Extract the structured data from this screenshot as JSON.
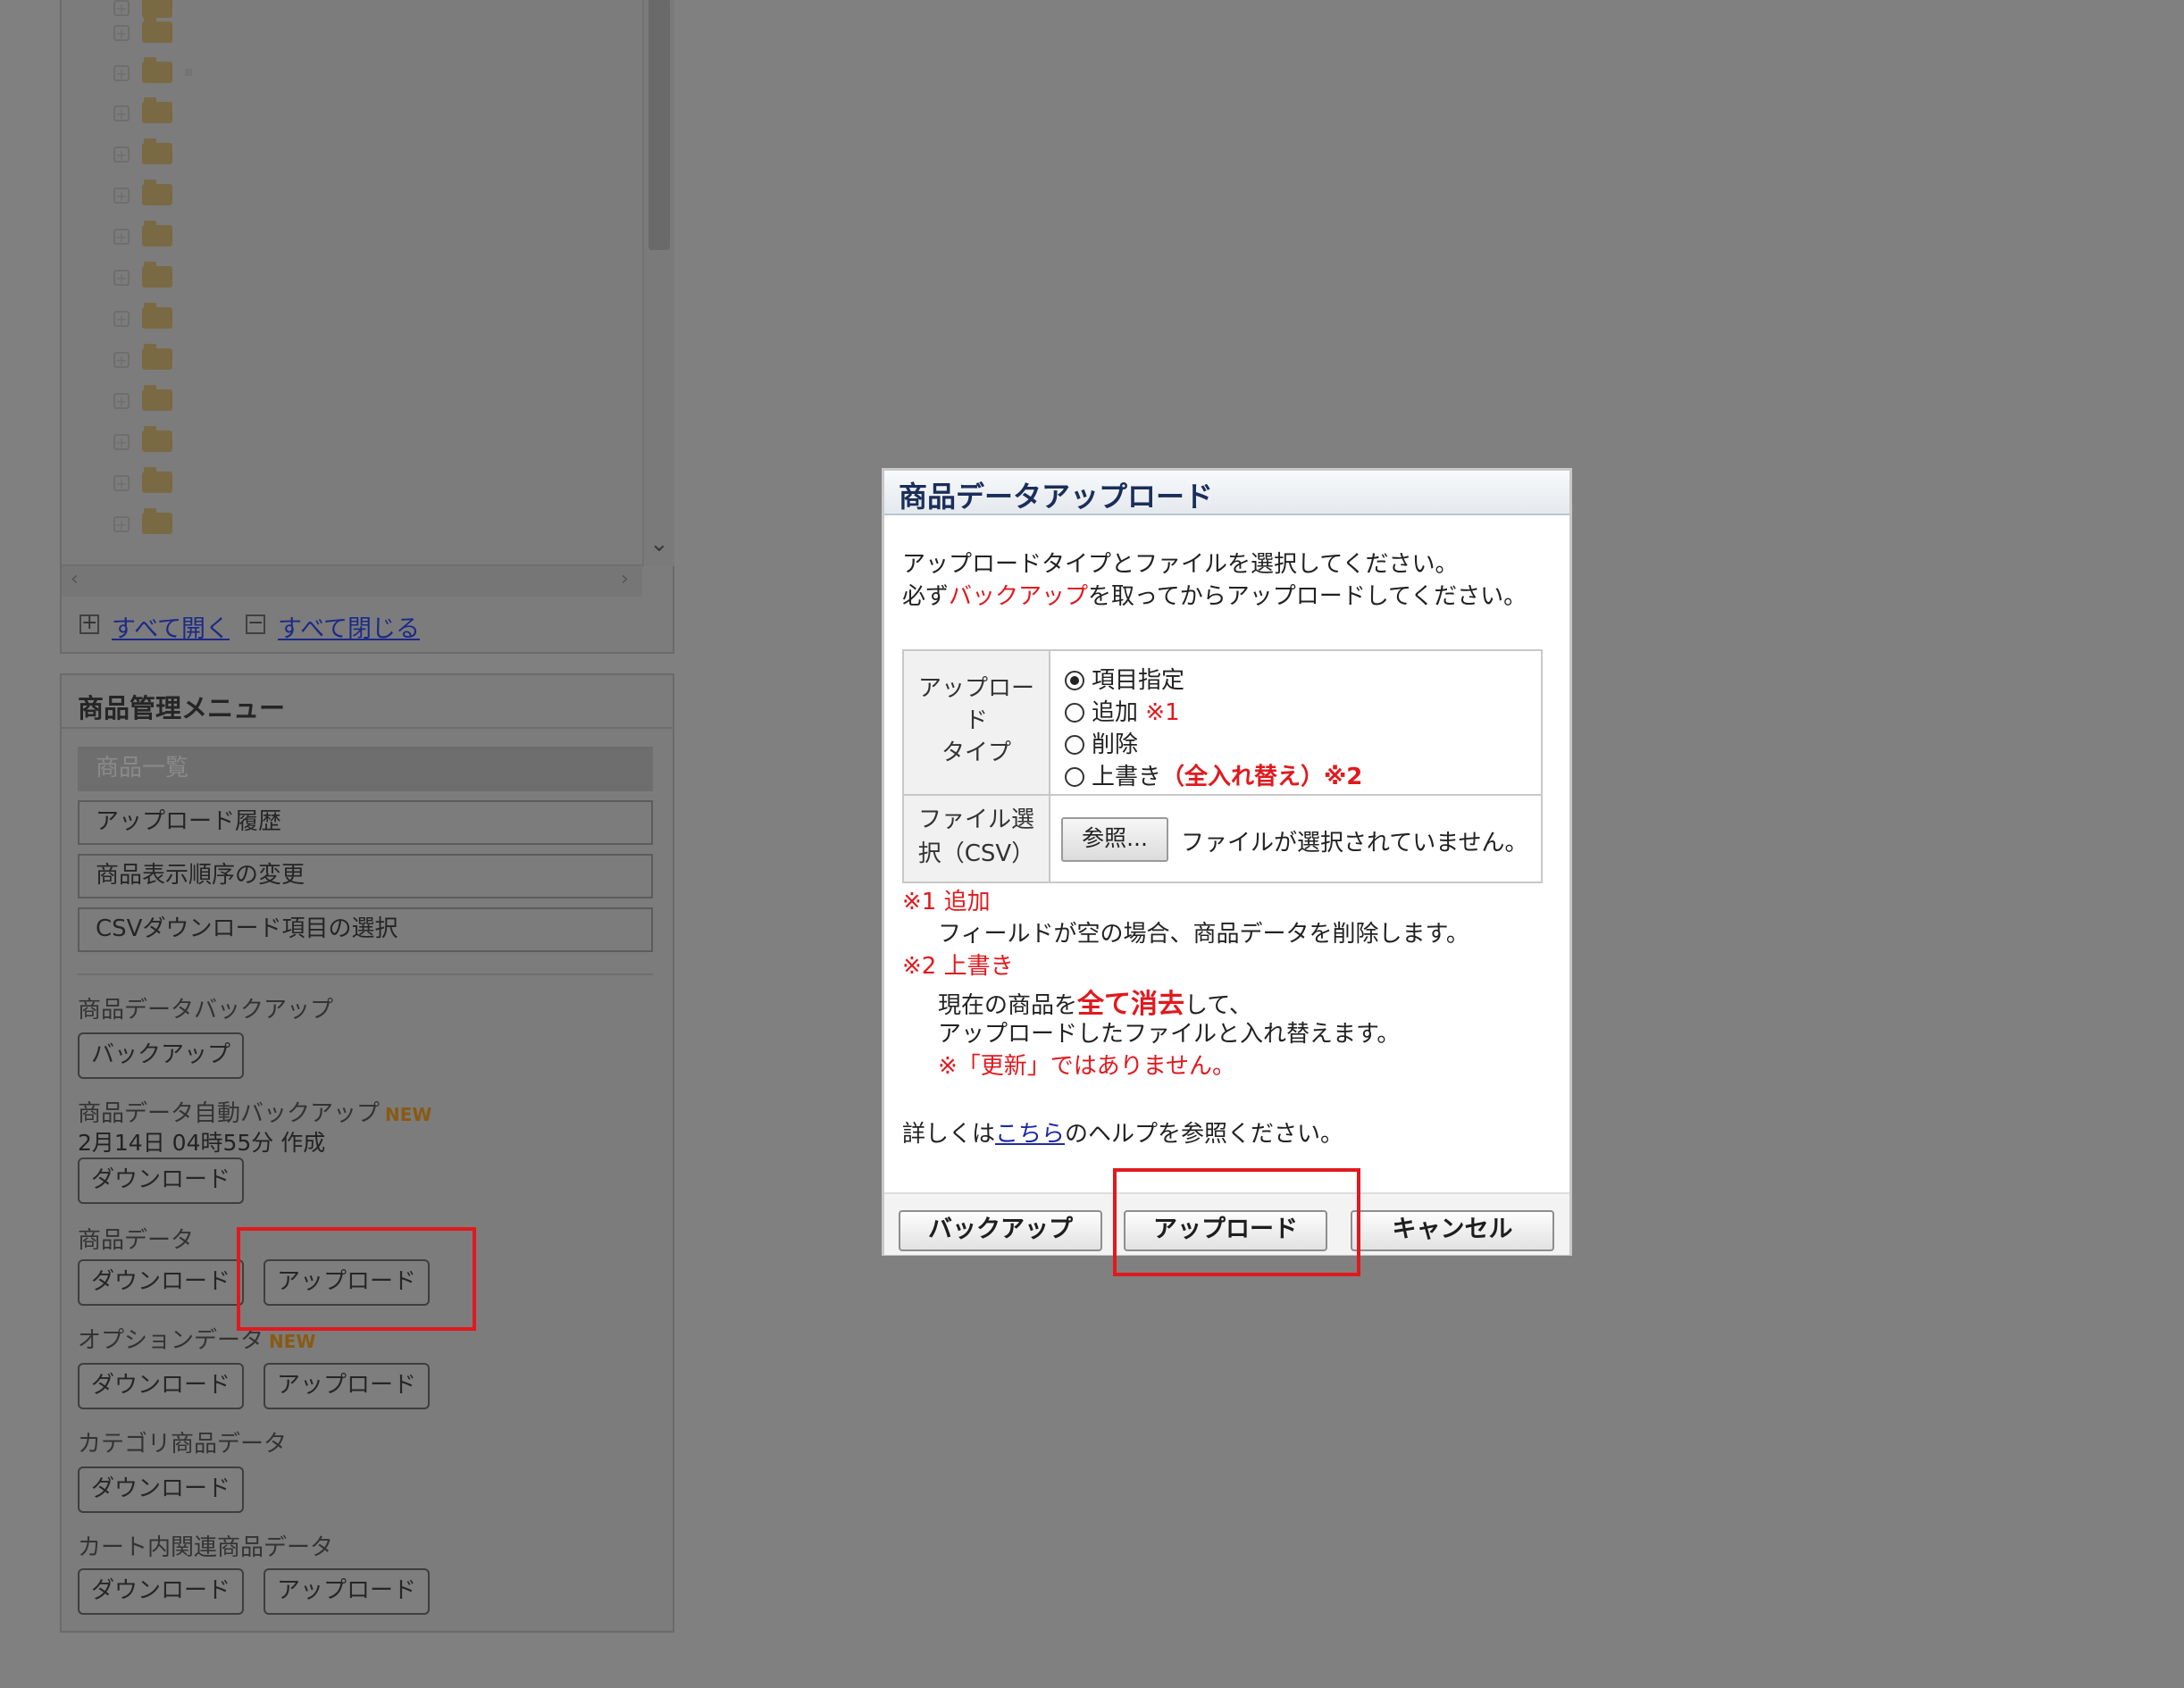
{
  "tree": {
    "expand_all": "すべて開く",
    "collapse_all": "すべて閉じる"
  },
  "menu": {
    "title": "商品管理メニュー",
    "items": [
      {
        "label": "商品一覧",
        "active": true
      },
      {
        "label": "アップロード履歴",
        "active": false
      },
      {
        "label": "商品表示順序の変更",
        "active": false
      },
      {
        "label": "CSVダウンロード項目の選択",
        "active": false
      }
    ],
    "backup": {
      "label": "商品データバックアップ",
      "button": "バックアップ"
    },
    "auto_backup": {
      "label": "商品データ自動バックアップ",
      "badge": "NEW",
      "timestamp": "2月14日 04時55分 作成",
      "button": "ダウンロード"
    },
    "product_data": {
      "label": "商品データ",
      "download": "ダウンロード",
      "upload": "アップロード"
    },
    "option_data": {
      "label": "オプションデータ",
      "badge": "NEW",
      "download": "ダウンロード",
      "upload": "アップロード"
    },
    "category_data": {
      "label": "カテゴリ商品データ",
      "download": "ダウンロード"
    },
    "cart_data": {
      "label": "カート内関連商品データ",
      "download": "ダウンロード",
      "upload": "アップロード"
    }
  },
  "dialog": {
    "title": "商品データアップロード",
    "intro_line1": "アップロードタイプとファイルを選択してください。",
    "intro_line2_pre": "必ず",
    "intro_line2_red": "バックアップ",
    "intro_line2_post": "を取ってからアップロードしてください。",
    "upload_type_label_1": "アップロー",
    "upload_type_label_2": "ド",
    "upload_type_label_3": "タイプ",
    "options": [
      {
        "label": "項目指定",
        "note": "",
        "selected": true
      },
      {
        "label": "追加",
        "note": "※1",
        "selected": false
      },
      {
        "label": "削除",
        "note": "",
        "selected": false
      },
      {
        "label": "上書き",
        "note": "（全入れ替え）※2",
        "selected": false
      }
    ],
    "file_label_1": "ファイル選",
    "file_label_2": "択（CSV）",
    "browse_button": "参照...",
    "file_status": "ファイルが選択されていません。",
    "note1_title": "※1 追加",
    "note1_text": "フィールドが空の場合、商品データを削除します。",
    "note2_title": "※2 上書き",
    "note2_pre": "現在の商品を",
    "note2_bold": "全て消去",
    "note2_post": "して、",
    "note2_line2": "アップロードしたファイルと入れ替えます。",
    "note2_line3": "※「更新」ではありません。",
    "help_pre": "詳しくは",
    "help_link": "こちら",
    "help_post": "のヘルプを参照ください。",
    "buttons": {
      "backup": "バックアップ",
      "upload": "アップロード",
      "cancel": "キャンセル"
    }
  },
  "colors": {
    "overlay": "#808080",
    "highlight": "#e1191e",
    "dialog_title": "#1b2e5a",
    "link": "#1c2aa4"
  }
}
